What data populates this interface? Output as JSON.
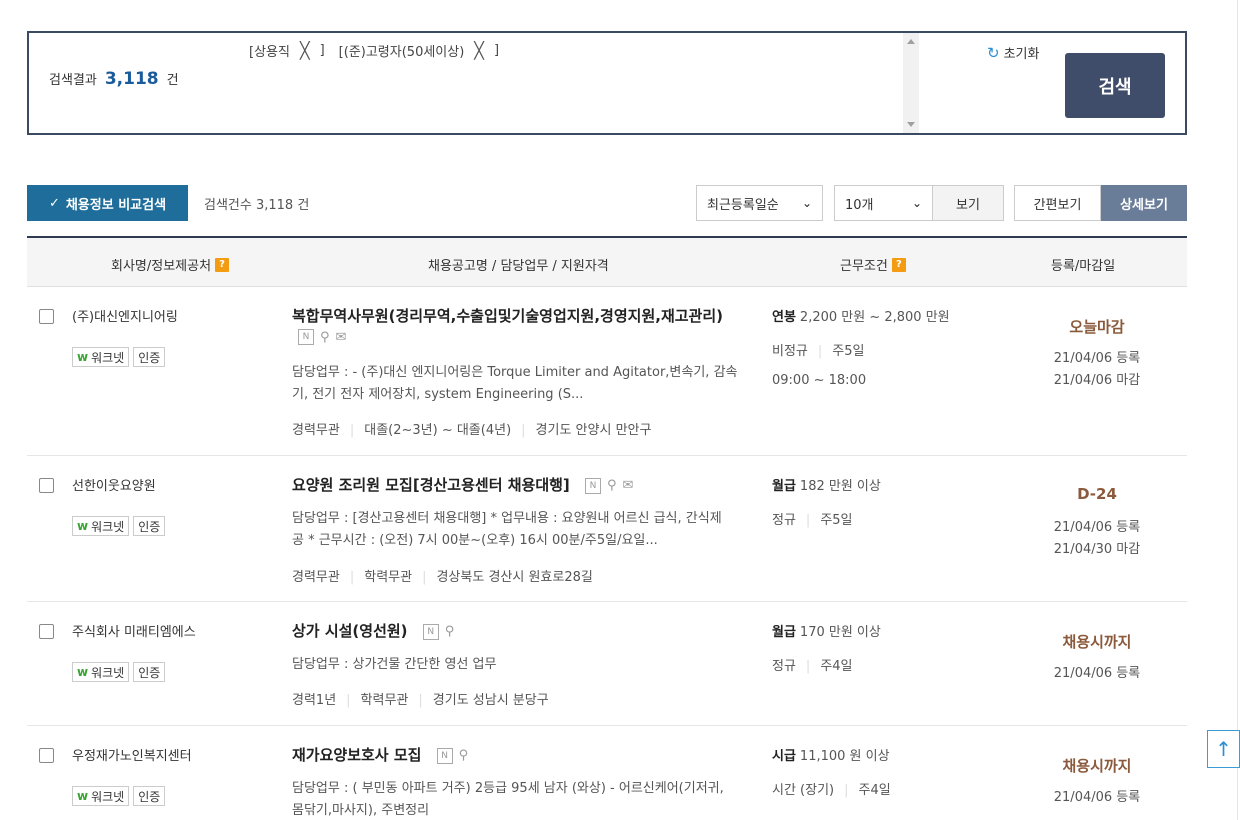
{
  "search": {
    "chips": [
      {
        "label": "[상용직",
        "close": "╳",
        "end": "]"
      },
      {
        "label": "[(준)고령자(50세이상)",
        "close": "╳",
        "end": "]"
      }
    ],
    "result_label": "검색결과",
    "result_count": "3,118",
    "result_unit": "건",
    "reset_icon": "refresh-icon",
    "reset_label": "초기화",
    "search_button": "검색"
  },
  "toolbar": {
    "compare_label": "채용정보 비교검색",
    "total_label": "검색건수 3,118 건",
    "sort_value": "최근등록일순",
    "count_value": "10개",
    "view_button": "보기",
    "simple_view": "간편보기",
    "detail_view": "상세보기"
  },
  "table": {
    "headers": {
      "company": "회사명/정보제공처",
      "title": "채용공고명 / 담당업무 / 지원자격",
      "conditions": "근무조건",
      "dates": "등록/마감일"
    },
    "help_mark": "?"
  },
  "rows": [
    {
      "company": "(주)대신엔지니어링",
      "badge_worknet": "워크넷",
      "badge_cert": "인증",
      "title": "복합무역사무원(경리무역,수출입및기술영업지원,경영지원,재고관리)",
      "duty_line1": "담당업무 : - (주)대신 엔지니어링은 Torque Limiter and Agitator,변속기, 감속",
      "duty_line2": "기, 전기 전자 제어장치, system Engineering (S...",
      "meta": [
        "경력무관",
        "대졸(2~3년) ~ 대졸(4년)",
        "경기도 안양시 만안구"
      ],
      "pay_type": "연봉",
      "pay_value": "2,200 만원 ~ 2,800 만원",
      "conditions": [
        "비정규",
        "주5일"
      ],
      "hours": "09:00 ~ 18:00",
      "deadline": "오늘마감",
      "registered": "21/04/06 등록",
      "closing": "21/04/06 마감"
    },
    {
      "company": "선한이웃요양원",
      "badge_worknet": "워크넷",
      "badge_cert": "인증",
      "title": "요양원 조리원 모집[경산고용센터 채용대행]",
      "duty_line1": "담당업무 : [경산고용센터 채용대행] * 업무내용 : 요양원내 어르신 급식, 간식제",
      "duty_line2": "공 * 근무시간 : (오전) 7시 00분~(오후) 16시 00분/주5일/요일...",
      "meta": [
        "경력무관",
        "학력무관",
        "경상북도 경산시 원효로28길"
      ],
      "pay_type": "월급",
      "pay_value": "182 만원 이상",
      "conditions": [
        "정규",
        "주5일"
      ],
      "deadline": "D-24",
      "registered": "21/04/06 등록",
      "closing": "21/04/30 마감"
    },
    {
      "company": "주식회사 미래티엠에스",
      "badge_worknet": "워크넷",
      "badge_cert": "인증",
      "title": "상가 시설(영선원)",
      "duty_line1": "담당업무 : 상가건물 간단한 영선 업무",
      "meta": [
        "경력1년",
        "학력무관",
        "경기도 성남시 분당구"
      ],
      "pay_type": "월급",
      "pay_value": "170 만원 이상",
      "conditions": [
        "정규",
        "주4일"
      ],
      "deadline": "채용시까지",
      "registered": "21/04/06 등록"
    },
    {
      "company": "우정재가노인복지센터",
      "badge_worknet": "워크넷",
      "badge_cert": "인증",
      "title": "재가요양보호사 모집",
      "duty_line1": "담당업무 : ( 부민동 아파트 거주) 2등급 95세 남자 (와상) - 어르신케어(기저귀,",
      "duty_line2": "몸닦기,마사지), 주변정리",
      "pay_type": "시급",
      "pay_value": "11,100 원 이상",
      "conditions": [
        "시간 (장기)",
        "주4일"
      ],
      "deadline": "채용시까지",
      "registered": "21/04/06 등록"
    }
  ],
  "icons": {
    "new_mark": "new-badge-icon",
    "detail": "search-icon",
    "mail": "mail-icon",
    "scroll_top": "arrow-up-icon"
  }
}
